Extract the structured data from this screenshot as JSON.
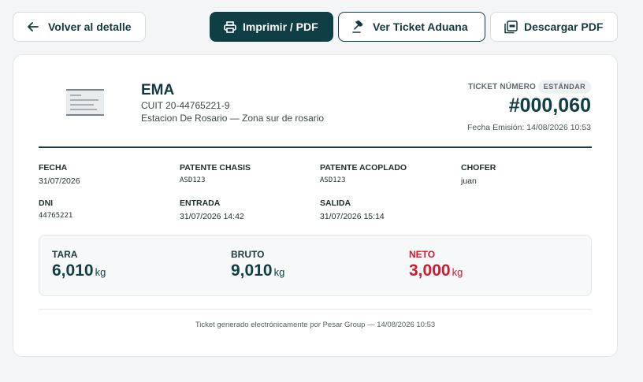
{
  "toolbar": {
    "back_label": "Volver al detalle",
    "print_label": "Imprimir / PDF",
    "aduana_label": "Ver Ticket Aduana",
    "download_label": "Descargar PDF"
  },
  "company": {
    "name": "EMA",
    "cuit": "CUIT 20-44765221-9",
    "address": "Estacion De Rosario — Zona sur de rosario"
  },
  "ticket": {
    "label": "TICKET NÚMERO",
    "badge": "ESTÁNDAR",
    "number": "#000,060",
    "issue_date": "Fecha Emisión: 14/08/2026 10:53"
  },
  "fields": {
    "fecha": {
      "label": "FECHA",
      "value": "31/07/2026"
    },
    "patente_chasis": {
      "label": "PATENTE CHASIS",
      "value": "ASD123"
    },
    "patente_acoplado": {
      "label": "PATENTE ACOPLADO",
      "value": "ASD123"
    },
    "chofer": {
      "label": "CHOFER",
      "value": "juan"
    },
    "dni": {
      "label": "DNI",
      "value": "44765221"
    },
    "entrada": {
      "label": "ENTRADA",
      "value": "31/07/2026 14:42"
    },
    "salida": {
      "label": "SALIDA",
      "value": "31/07/2026 15:14"
    }
  },
  "weights": {
    "tara": {
      "label": "TARA",
      "value": "6,010",
      "unit": "kg"
    },
    "bruto": {
      "label": "BRUTO",
      "value": "9,010",
      "unit": "kg"
    },
    "neto": {
      "label": "NETO",
      "value": "3,000",
      "unit": "kg"
    }
  },
  "footer": "Ticket generado electrónicamente por Pesar Group — 14/08/2026 10:53",
  "colors": {
    "primary": "#0f3f44",
    "neto": "#d0192b",
    "background": "#f4f5f6"
  },
  "icons": {
    "back": "arrow-left-icon",
    "print": "printer-icon",
    "aduana": "gavel-icon",
    "pdf": "pdf-file-icon",
    "logo": "company-logo"
  }
}
